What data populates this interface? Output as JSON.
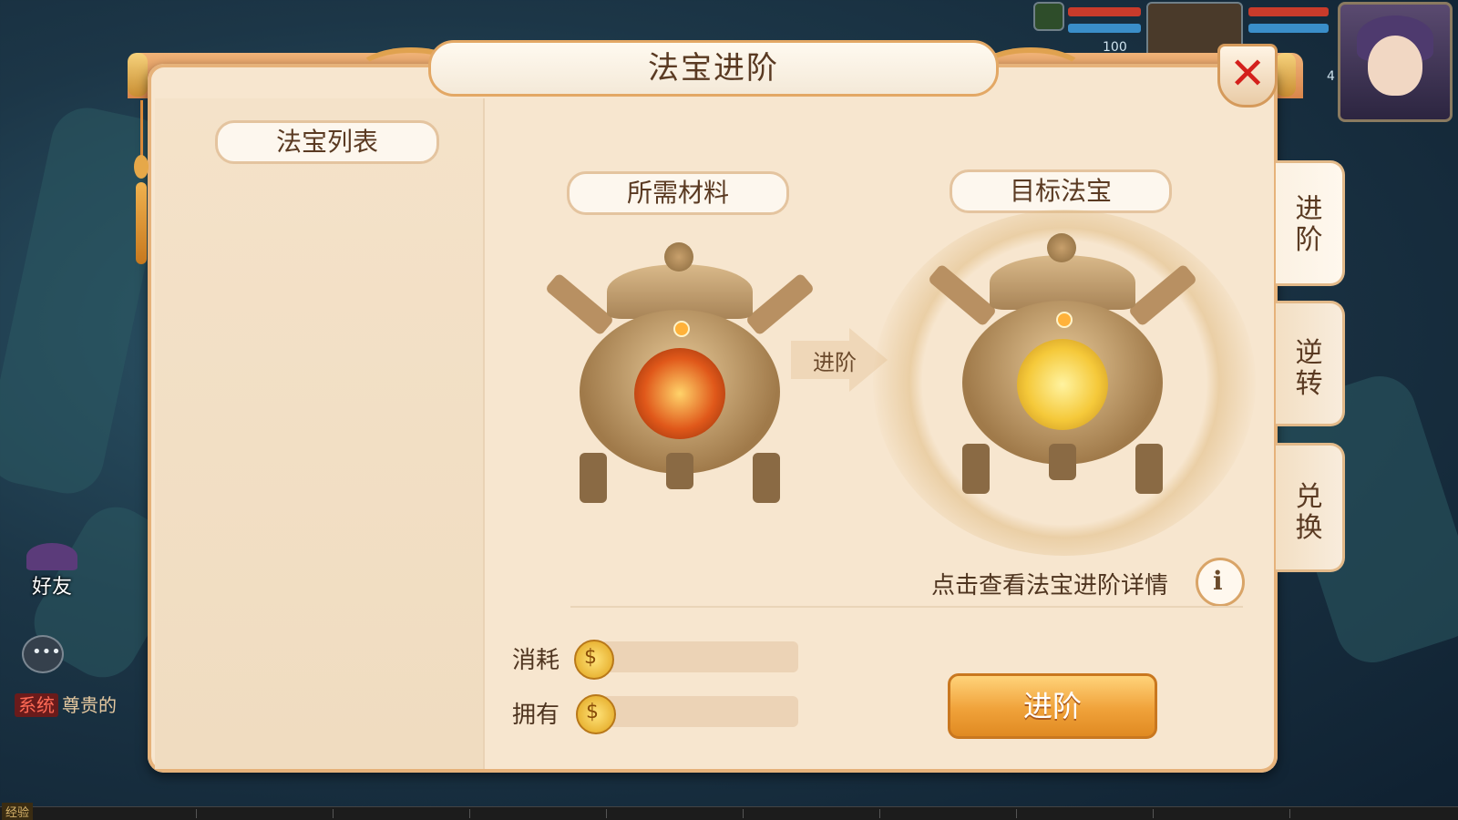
{
  "dialog": {
    "title": "法宝进阶"
  },
  "left_panel": {
    "header": "法宝列表"
  },
  "materials": {
    "header": "所需材料"
  },
  "target": {
    "header": "目标法宝"
  },
  "arrow": {
    "label": "进阶"
  },
  "tabs": [
    {
      "label_top": "进",
      "label_bottom": "阶",
      "active": true
    },
    {
      "label_top": "逆",
      "label_bottom": "转",
      "active": false
    },
    {
      "label_top": "兑",
      "label_bottom": "换",
      "active": false
    }
  ],
  "detail_link": {
    "text": "点击查看法宝进阶详情",
    "icon": "info-icon"
  },
  "cost": {
    "consume_label": "消耗",
    "own_label": "拥有",
    "coin_icon": "gold-coin-icon"
  },
  "action_button": {
    "label": "进阶"
  },
  "hud": {
    "level_number": "100",
    "level_number_2": "4"
  },
  "sidebar": {
    "friends_label": "好友"
  },
  "chat": {
    "system_tag": "系统",
    "system_text": "尊贵的"
  },
  "bottom": {
    "exp_label": "经验"
  },
  "colors": {
    "accent": "#e0a24f",
    "panel_bg": "#f7e6cf",
    "close_x": "#d4201c",
    "button": "#f0a23a"
  }
}
